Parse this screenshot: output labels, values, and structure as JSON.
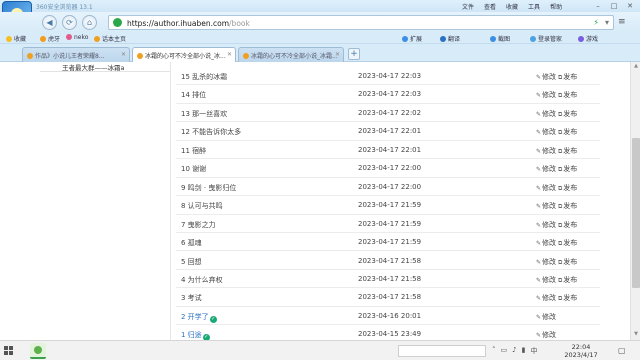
{
  "browser": {
    "app_title": "360安全浏览器 13.1",
    "menu": [
      "文件",
      "查看",
      "收藏",
      "工具",
      "帮助"
    ],
    "url": {
      "scheme": "https://",
      "host": "author.ihuaben.com",
      "path": "/book"
    },
    "bookmarks": [
      "收藏",
      "虎牙",
      "neko",
      "话本主页"
    ],
    "toolbar_right": [
      "扩展",
      "翻译",
      "截图",
      "登录管家",
      "游戏"
    ],
    "tabs": [
      {
        "label": "作品》小说儿王者荣耀8...",
        "active": false
      },
      {
        "label": "冰霜的心可不冷全部小说_冰...",
        "active": true
      },
      {
        "label": "冰霜的心可不冷全部小说_冰霜...",
        "active": false
      }
    ],
    "new_tab": "+"
  },
  "content": {
    "author_line": "王者最大群——冰霜a",
    "chapters": [
      {
        "title": "15 乱杀的冰霜",
        "time": "2023-04-17 22:03",
        "published": false,
        "edit": "修改",
        "publish": "发布"
      },
      {
        "title": "14 排位",
        "time": "2023-04-17 22:03",
        "published": false,
        "edit": "修改",
        "publish": "发布"
      },
      {
        "title": "13 那一丝喜欢",
        "time": "2023-04-17 22:02",
        "published": false,
        "edit": "修改",
        "publish": "发布"
      },
      {
        "title": "12 不能告诉你太多",
        "time": "2023-04-17 22:01",
        "published": false,
        "edit": "修改",
        "publish": "发布"
      },
      {
        "title": "11 宿醉",
        "time": "2023-04-17 22:01",
        "published": false,
        "edit": "修改",
        "publish": "发布"
      },
      {
        "title": "10 谢谢",
        "time": "2023-04-17 22:00",
        "published": false,
        "edit": "修改",
        "publish": "发布"
      },
      {
        "title": "9 鸣剑 · 曳影归位",
        "time": "2023-04-17 22:00",
        "published": false,
        "edit": "修改",
        "publish": "发布"
      },
      {
        "title": "8 认可与共鸣",
        "time": "2023-04-17 21:59",
        "published": false,
        "edit": "修改",
        "publish": "发布"
      },
      {
        "title": "7 曳影之力",
        "time": "2023-04-17 21:59",
        "published": false,
        "edit": "修改",
        "publish": "发布"
      },
      {
        "title": "6 孤魂",
        "time": "2023-04-17 21:59",
        "published": false,
        "edit": "修改",
        "publish": "发布"
      },
      {
        "title": "5 回想",
        "time": "2023-04-17 21:58",
        "published": false,
        "edit": "修改",
        "publish": "发布"
      },
      {
        "title": "4 为什么弃权",
        "time": "2023-04-17 21:58",
        "published": false,
        "edit": "修改",
        "publish": "发布"
      },
      {
        "title": "3 考试",
        "time": "2023-04-17 21:58",
        "published": false,
        "edit": "修改",
        "publish": "发布"
      },
      {
        "title": "2 开学了",
        "time": "2023-04-16 20:01",
        "published": true,
        "edit": "修改",
        "publish": ""
      },
      {
        "title": "1 归途",
        "time": "2023-04-15 23:49",
        "published": true,
        "edit": "修改",
        "publish": ""
      }
    ]
  },
  "taskbar": {
    "time": "22:04",
    "date": "2023/4/17"
  },
  "colors": {
    "link_blue": "#2a70c4",
    "published_green": "#19a974",
    "chrome_blue": "#d8ebf8"
  }
}
